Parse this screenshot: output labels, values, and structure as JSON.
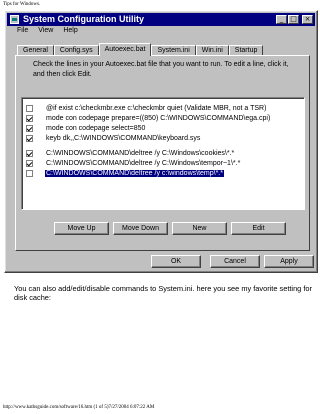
{
  "page": {
    "header": "Tips for Windows.",
    "footer": "http://www.kathsguide.com/software/16.htm (1 of 5)7/27/2004 6:07:22 AM",
    "caption": "You can also add/edit/disable commands to System.ini. here you see my favorite setting for disk cache:"
  },
  "window": {
    "title": "System Configuration Utility",
    "controls": {
      "minimize": "_",
      "maximize": "□",
      "close": "×"
    },
    "menu": [
      "File",
      "View",
      "Help"
    ],
    "tabs": [
      {
        "label": "General",
        "active": false
      },
      {
        "label": "Config.sys",
        "active": false
      },
      {
        "label": "Autoexec.bat",
        "active": true
      },
      {
        "label": "System.ini",
        "active": false
      },
      {
        "label": "Win.ini",
        "active": false
      },
      {
        "label": "Startup",
        "active": false
      }
    ],
    "instructions": "Check the lines in your Autoexec.bat file that you want to run. To edit a line, click it, and then click Edit.",
    "lines": [
      {
        "text": "@if exist c:\\checkmbr.exe c:\\checkmbr quiet (Validate MBR, not a TSR)",
        "checked": false,
        "selected": false
      },
      {
        "text": "mode con codepage prepare=((850) C:\\WINDOWS\\COMMAND\\ega.cpi)",
        "checked": true,
        "selected": false
      },
      {
        "text": "mode con codepage select=850",
        "checked": true,
        "selected": false
      },
      {
        "text": "keyb dk,,C:\\WINDOWS\\COMMAND\\keyboard.sys",
        "checked": true,
        "selected": false
      },
      {
        "text": "C:\\WINDOWS\\COMMAND\\deltree /y C:\\Windows\\cookies\\*.*",
        "checked": true,
        "selected": false
      },
      {
        "text": "C:\\WINDOWS\\COMMAND\\deltree /y C:\\Windows\\tempor~1\\*.*",
        "checked": true,
        "selected": false
      },
      {
        "text": "C:\\WINDOWS\\COMMAND\\deltree /y c:\\windows\\temp\\*.*",
        "checked": false,
        "selected": true
      }
    ],
    "actions": {
      "move_up": "Move Up",
      "move_down": "Move Down",
      "new": "New",
      "edit": "Edit"
    },
    "dialog": {
      "ok": "OK",
      "cancel": "Cancel",
      "apply": "Apply"
    }
  }
}
